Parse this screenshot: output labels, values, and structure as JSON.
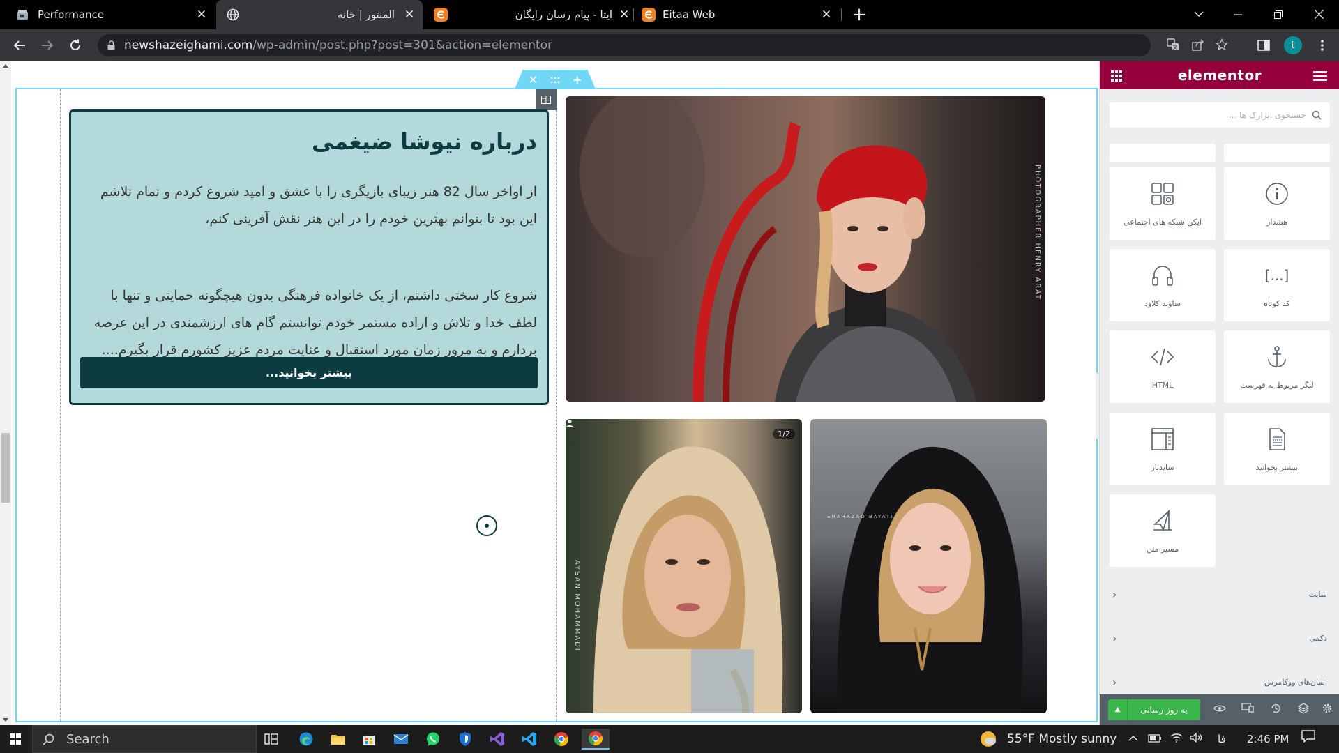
{
  "browser": {
    "tabs": [
      {
        "title": "Performance",
        "icon": "performance-favicon"
      },
      {
        "title": "المنتور | خانه",
        "icon": "globe-icon"
      },
      {
        "title": "ایتا - پیام رسان رایگان",
        "icon": "eitaa-favicon"
      },
      {
        "title": "Eitaa Web",
        "icon": "eitaa-favicon"
      }
    ],
    "close_glyph": "✕",
    "new_tab_glyph": "+",
    "url_host": "newshazeighami.com",
    "url_path": "/wp-admin/post.php?post=301&action=elementor",
    "profile_initial": "t"
  },
  "page": {
    "about_title": "درباره نیوشا ضیغمی",
    "about_paragraph_1": "از اواخر سال 82 هنر زیبای بازیگری را با عشق و امید شروع کردم و تمام تلاشم این بود تا بتوانم بهترین خودم را در این هنر نقش آفرینی کنم،",
    "about_paragraph_2": "شروع کار سختی داشتم، از یک خانواده فرهنگی بدون هیچگونه حمایتی و تنها با لطف خدا و تلاش و اراده مستمر خودم توانستم گام های ارزشمندی در این عرصه بردارم و به مرور زمان مورد استقبال و عنایت مردم عزیز کشورم قرار بگیرم....",
    "read_more_label": "بیشتر بخوانید...",
    "photo_credit_big": "PHOTOGRAPHER HENRY ARAT",
    "photo_credit_left": "AYSAN MOHAMMADI",
    "photo_credit_right": "SHAHRZAD BAYATI",
    "gallery_counter": "1/2"
  },
  "elementor": {
    "logo": "elementor",
    "search_placeholder": "جستجوی ابزارک ها ...",
    "widgets": [
      {
        "label": "هشدار",
        "icon": "info-circle-icon"
      },
      {
        "label": "آیکن شبکه های اجتماعی",
        "icon": "social-icons-icon"
      },
      {
        "label": "کد کوتاه",
        "icon": "shortcode-icon",
        "glyph": "[...]"
      },
      {
        "label": "ساوند کلاود",
        "icon": "soundcloud-headphones-icon"
      },
      {
        "label": "لنگر مربوط به فهرست",
        "icon": "menu-anchor-icon"
      },
      {
        "label": "HTML",
        "icon": "html-code-icon"
      },
      {
        "label": "بیشتر بخوانید",
        "icon": "read-more-icon"
      },
      {
        "label": "ساید‌بار",
        "icon": "sidebar-icon"
      },
      {
        "label": "مسیر متن",
        "icon": "text-path-icon"
      }
    ],
    "categories": [
      {
        "label": "سایت"
      },
      {
        "label": "دکمی"
      },
      {
        "label": "المان‌های ووکامرس"
      }
    ],
    "publish_label": "به روز رسانی",
    "accent_color": "#93003c",
    "publish_color": "#39b54a"
  },
  "taskbar": {
    "search_label": "Search",
    "weather": "55°F  Mostly sunny",
    "language": "فا",
    "time": "2:46 PM"
  }
}
